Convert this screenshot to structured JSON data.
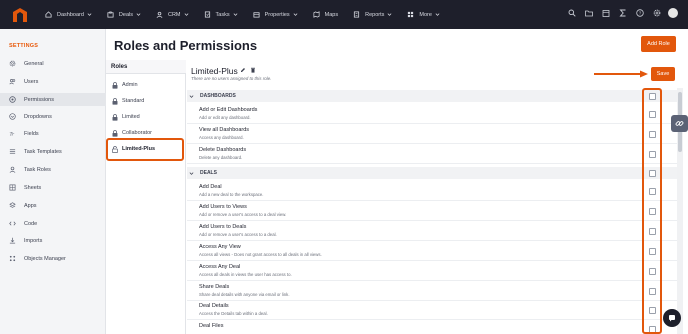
{
  "topnav": {
    "items": [
      {
        "label": "Dashboard",
        "icon": "home-icon",
        "dropdown": true
      },
      {
        "label": "Deals",
        "icon": "deals-icon",
        "dropdown": true
      },
      {
        "label": "CRM",
        "icon": "crm-icon",
        "dropdown": true
      },
      {
        "label": "Tasks",
        "icon": "tasks-icon",
        "dropdown": true
      },
      {
        "label": "Properties",
        "icon": "properties-icon",
        "dropdown": true
      },
      {
        "label": "Maps",
        "icon": "maps-icon",
        "dropdown": false
      },
      {
        "label": "Reports",
        "icon": "reports-icon",
        "dropdown": true
      },
      {
        "label": "More",
        "icon": "grid-icon",
        "dropdown": true
      }
    ],
    "right_icons": [
      "search-icon",
      "folder-icon",
      "calendar-icon",
      "sigma-icon",
      "help-icon",
      "gear-icon"
    ]
  },
  "sidebar": {
    "title": "SETTINGS",
    "items": [
      {
        "label": "General",
        "icon": "gear-icon"
      },
      {
        "label": "Users",
        "icon": "users-icon"
      },
      {
        "label": "Permissions",
        "icon": "permissions-icon",
        "active": true
      },
      {
        "label": "Dropdowns",
        "icon": "dropdown-icon"
      },
      {
        "label": "Fields",
        "icon": "fields-icon"
      },
      {
        "label": "Task Templates",
        "icon": "task-templates-icon"
      },
      {
        "label": "Task Roles",
        "icon": "task-roles-icon"
      },
      {
        "label": "Sheets",
        "icon": "sheets-icon"
      },
      {
        "label": "Apps",
        "icon": "apps-icon"
      },
      {
        "label": "Code",
        "icon": "code-icon"
      },
      {
        "label": "Imports",
        "icon": "imports-icon"
      },
      {
        "label": "Objects Manager",
        "icon": "objects-icon"
      }
    ]
  },
  "header": {
    "title": "Roles and Permissions",
    "add_role_label": "Add Role"
  },
  "roles": {
    "heading": "Roles",
    "items": [
      {
        "label": "Admin"
      },
      {
        "label": "Standard"
      },
      {
        "label": "Limited"
      },
      {
        "label": "Collaborator"
      },
      {
        "label": "Limited-Plus",
        "active": true
      }
    ]
  },
  "detail": {
    "role_name": "Limited-Plus",
    "subtitle": "There are no users assigned to this role.",
    "save_label": "Save"
  },
  "sections": [
    {
      "title": "DASHBOARDS",
      "permissions": [
        {
          "name": "Add or Edit Dashboards",
          "desc": "Add or edit any dashboard."
        },
        {
          "name": "View all Dashboards",
          "desc": "Access any dashboard."
        },
        {
          "name": "Delete Dashboards",
          "desc": "Delete any dashboard."
        }
      ]
    },
    {
      "title": "DEALS",
      "permissions": [
        {
          "name": "Add Deal",
          "desc": "Add a new deal to the workspace."
        },
        {
          "name": "Add Users to Views",
          "desc": "Add or remove a user's access to a deal view."
        },
        {
          "name": "Add Users to Deals",
          "desc": "Add or remove a user's access to a deal."
        },
        {
          "name": "Access Any View",
          "desc": "Access all views - Does not grant access to all deals in all views."
        },
        {
          "name": "Access Any Deal",
          "desc": "Access all deals in views the user has access to."
        },
        {
          "name": "Share Deals",
          "desc": "Share deal details with anyone via email or link."
        },
        {
          "name": "Deal Details",
          "desc": "Access the Details tab within a deal."
        },
        {
          "name": "Deal Files",
          "desc": ""
        }
      ]
    }
  ],
  "colors": {
    "accent": "#e2570c",
    "nav_bg": "#1e1f2b",
    "sidebar_bg": "#f4f5f7"
  }
}
